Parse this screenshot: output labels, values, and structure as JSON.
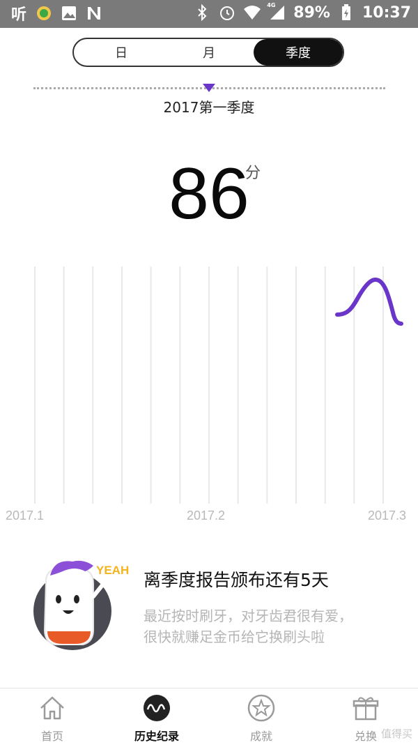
{
  "status_bar": {
    "left_icons": [
      "ting-app-icon",
      "notification-icon",
      "image-icon",
      "n-icon"
    ],
    "battery": "89%",
    "time": "10:37",
    "network": "4G"
  },
  "segment": {
    "tabs": [
      {
        "label": "日",
        "active": false
      },
      {
        "label": "月",
        "active": false
      },
      {
        "label": "季度",
        "active": true
      }
    ]
  },
  "period": {
    "label": "2017第一季度"
  },
  "score": {
    "value": "86",
    "unit": "分"
  },
  "chart_data": {
    "type": "line",
    "x_tick_labels": [
      "2017.1",
      "2017.2",
      "2017.3"
    ],
    "series": [
      {
        "values": [],
        "color": "#6a35c9"
      }
    ],
    "grid": true
  },
  "notice": {
    "badge": "YEAH",
    "title": "离季度报告颁布还有5天",
    "body_line1": "最近按时刷牙，对牙齿君很有爱，",
    "body_line2": "很快就赚足金币给它换刷头啦"
  },
  "bottom_nav": {
    "items": [
      {
        "label": "首页",
        "icon": "home-icon",
        "active": false
      },
      {
        "label": "历史纪录",
        "icon": "wave-icon",
        "active": true
      },
      {
        "label": "成就",
        "icon": "star-icon",
        "active": false
      },
      {
        "label": "兑换",
        "icon": "gift-icon",
        "active": false
      }
    ]
  },
  "watermark": "值得买"
}
